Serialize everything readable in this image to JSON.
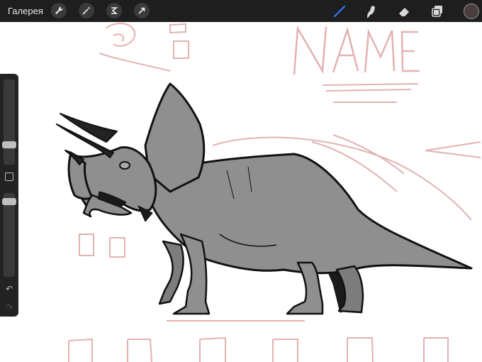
{
  "toolbar": {
    "gallery_label": "Галерея",
    "left_tools": [
      {
        "icon": "wrench-icon"
      },
      {
        "icon": "magic-wand-icon"
      },
      {
        "icon": "selection-icon"
      },
      {
        "icon": "transform-arrow-icon"
      }
    ],
    "right_tools": [
      {
        "icon": "brush-icon",
        "color": "#3a78ff"
      },
      {
        "icon": "smudge-icon"
      },
      {
        "icon": "eraser-icon"
      },
      {
        "icon": "layers-icon"
      }
    ],
    "current_color": "#4a3e3e"
  },
  "canvas": {
    "sketch_text": "NAME",
    "sketch_color": "#e3b2b2"
  },
  "sidebar": {
    "brush_size_level": 0.2,
    "opacity_level": 0.95
  }
}
